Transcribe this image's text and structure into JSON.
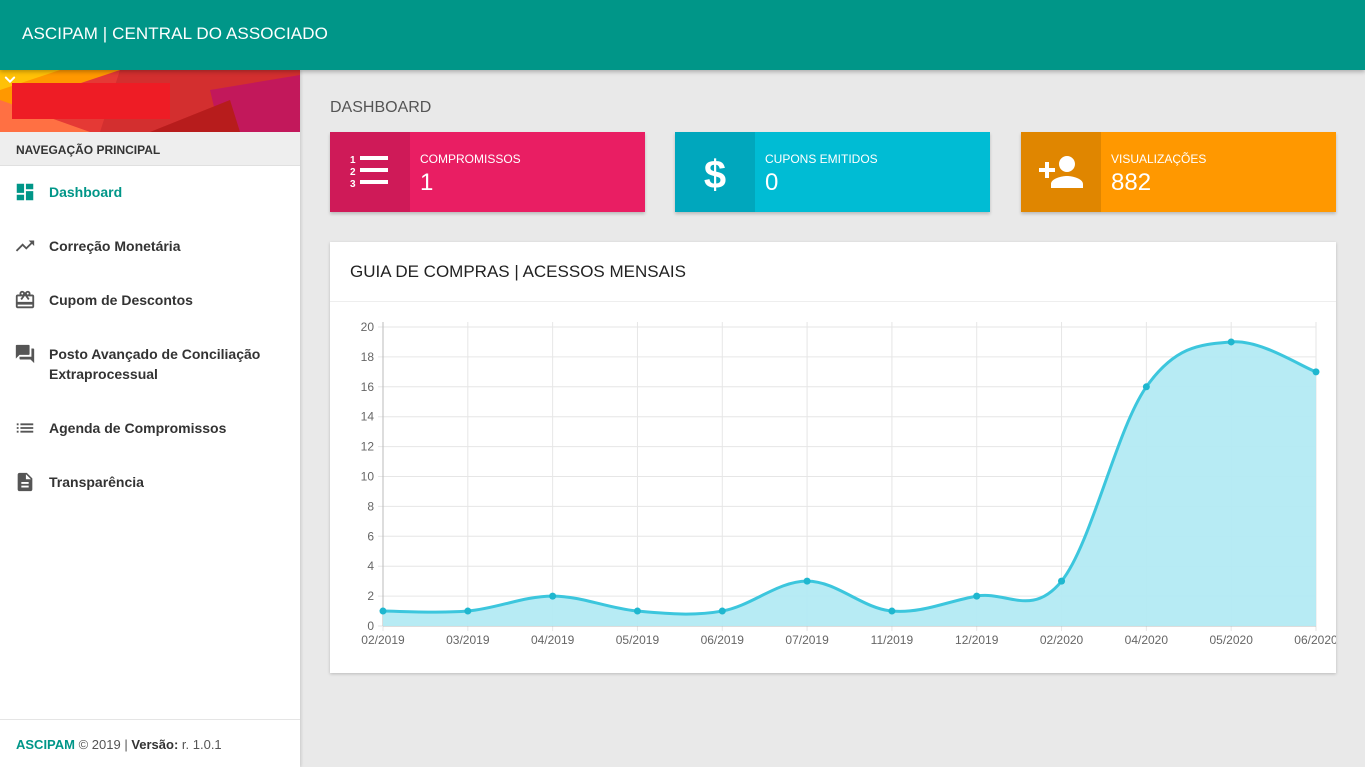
{
  "header": {
    "title": "ASCIPAM | CENTRAL DO ASSOCIADO"
  },
  "sidebar": {
    "nav_header": "NAVEGAÇÃO PRINCIPAL",
    "items": [
      {
        "label": "Dashboard",
        "icon": "dashboard-icon",
        "active": true
      },
      {
        "label": "Correção Monetária",
        "icon": "trending-up-icon"
      },
      {
        "label": "Cupom de Descontos",
        "icon": "gift-card-icon"
      },
      {
        "label": "Posto Avançado de Conciliação Extraprocessual",
        "icon": "forum-icon"
      },
      {
        "label": "Agenda de Compromissos",
        "icon": "list-icon"
      },
      {
        "label": "Transparência",
        "icon": "document-icon"
      }
    ],
    "footer": {
      "brand": "ASCIPAM",
      "copyright": " © 2019 | ",
      "version_label": "Versão:",
      "version": " r. 1.0.1"
    }
  },
  "main": {
    "title": "DASHBOARD",
    "info_boxes": [
      {
        "label": "COMPROMISSOS",
        "value": "1",
        "icon": "numbered-list-icon",
        "color": "#e91e63",
        "icon_bg": "#cf1a58"
      },
      {
        "label": "CUPONS EMITIDOS",
        "value": "0",
        "icon": "dollar-icon",
        "color": "#00bcd4",
        "icon_bg": "#00a7bd"
      },
      {
        "label": "VISUALIZAÇÕES",
        "value": "882",
        "icon": "person-add-icon",
        "color": "#ff9800",
        "icon_bg": "#e08600"
      }
    ],
    "chart_card": {
      "title": "GUIA DE COMPRAS | ACESSOS MENSAIS"
    }
  },
  "chart_data": {
    "type": "area",
    "title": "GUIA DE COMPRAS | ACESSOS MENSAIS",
    "categories": [
      "02/2019",
      "03/2019",
      "04/2019",
      "05/2019",
      "06/2019",
      "07/2019",
      "11/2019",
      "12/2019",
      "02/2020",
      "04/2020",
      "05/2020",
      "06/2020"
    ],
    "values": [
      1,
      1,
      2,
      1,
      1,
      3,
      1,
      2,
      3,
      16,
      19,
      17
    ],
    "ylim": [
      0,
      20
    ],
    "yticks": [
      0,
      2,
      4,
      6,
      8,
      10,
      12,
      14,
      16,
      18,
      20
    ],
    "grid": true,
    "line_color": "#3cc6dd",
    "fill_color": "#b3eaf3"
  }
}
